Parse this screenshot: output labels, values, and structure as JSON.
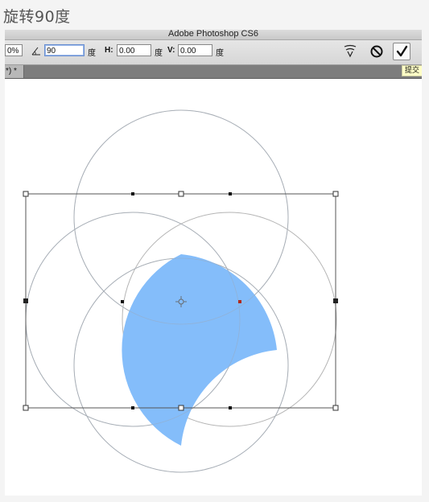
{
  "caption": "旋转90度",
  "window": {
    "title": "Adobe Photoshop CS6"
  },
  "options": {
    "scale_value": "0%",
    "angle_value": "90",
    "angle_unit": "度",
    "h_label": "H:",
    "h_value": "0.00",
    "h_unit": "度",
    "v_label": "V:",
    "v_value": "0.00",
    "v_unit": "度"
  },
  "icons": {
    "angle": "angle-icon",
    "warp": "warp-mode-icon",
    "cancel": "cancel-transform-icon",
    "commit": "checkmark-icon"
  },
  "tooltip": {
    "commit": "提交"
  },
  "document_tab": {
    "label": "*) *"
  },
  "colors": {
    "shape_fill": "#84bdfa",
    "guide_circle": "#b4b4b4",
    "bbox": "#555555",
    "anchor_red": "#b0281a"
  }
}
